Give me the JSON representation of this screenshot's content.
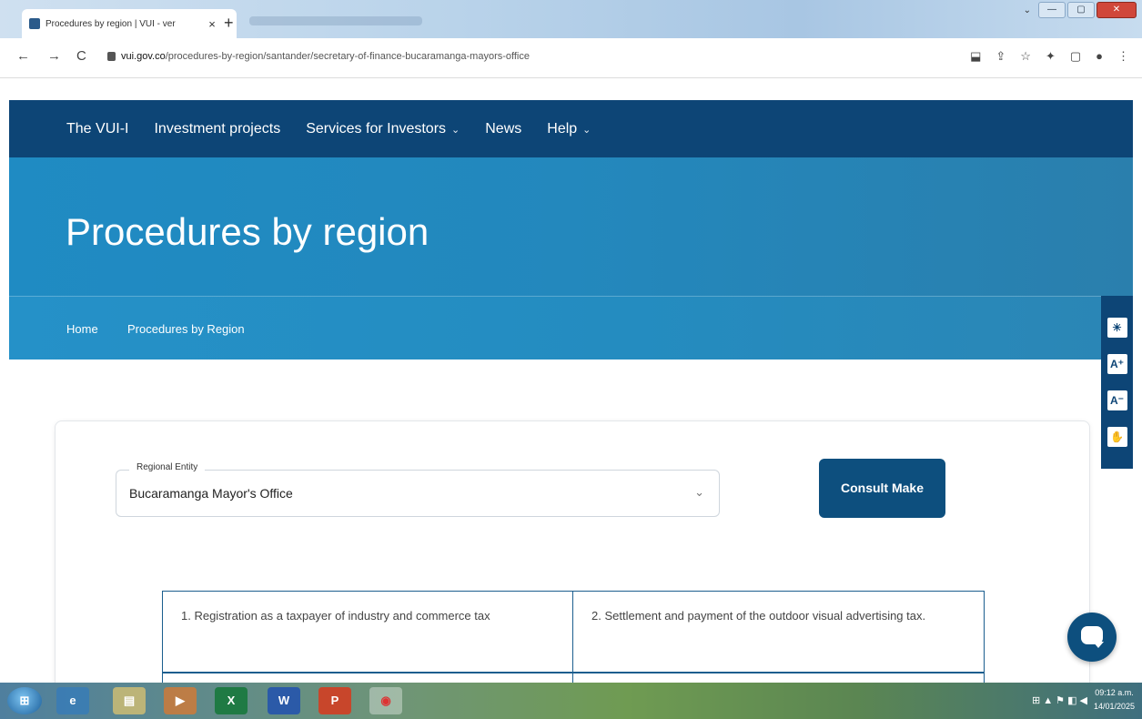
{
  "browser": {
    "tab_title": "Procedures by region | VUI - ver",
    "tab_close": "×",
    "new_tab": "+",
    "window_dropdown": "⌄",
    "minimize": "—",
    "maximize": "▢",
    "close": "✕",
    "back": "←",
    "forward": "→",
    "reload": "C",
    "url_domain": "vui.gov.co",
    "url_path": "/procedures-by-region/santander/secretary-of-finance-bucaramanga-mayors-office",
    "toolbar_icons": {
      "translate": "⬓",
      "share": "⇪",
      "bookmark": "☆",
      "extensions": "✦",
      "sidepanel": "▢",
      "profile": "●",
      "menu": "⋮"
    }
  },
  "nav": {
    "items": [
      {
        "label": "The VUI-I"
      },
      {
        "label": "Investment projects"
      },
      {
        "label": "Services for Investors",
        "caret": "⌄"
      },
      {
        "label": "News"
      },
      {
        "label": "Help",
        "caret": "⌄"
      }
    ]
  },
  "hero": {
    "title": "Procedures by region"
  },
  "breadcrumb": {
    "home": "Home",
    "current": "Procedures by Region"
  },
  "accessibility": {
    "contrast": "☀",
    "increase_font": "A⁺",
    "decrease_font": "A⁻",
    "sign_language": "✋"
  },
  "form": {
    "entity_label": "Regional Entity",
    "entity_value": "Bucaramanga Mayor's Office",
    "caret": "⌄",
    "consult_button": "Consult Make"
  },
  "procedures": [
    "1. Registration as a taxpayer of industry and commerce tax",
    "2. Settlement and payment of the outdoor visual advertising tax."
  ],
  "taskbar": {
    "apps": [
      {
        "name": "start",
        "glyph": "⊞"
      },
      {
        "name": "internet-explorer",
        "glyph": "e"
      },
      {
        "name": "file-explorer",
        "glyph": "▤"
      },
      {
        "name": "media-player",
        "glyph": "▶"
      },
      {
        "name": "excel",
        "glyph": "X"
      },
      {
        "name": "word",
        "glyph": "W"
      },
      {
        "name": "powerpoint",
        "glyph": "P"
      },
      {
        "name": "chrome",
        "glyph": "◉"
      }
    ],
    "tray": "⊞  ▲  ⚑  ◧  ◀",
    "time": "09:12 a.m.",
    "date": "14/01/2025"
  },
  "colors": {
    "nav_bg": "#0d4576",
    "hero_bg": "#2388bd",
    "button_bg": "#0d4f7e",
    "table_border": "#1b5e8e"
  }
}
